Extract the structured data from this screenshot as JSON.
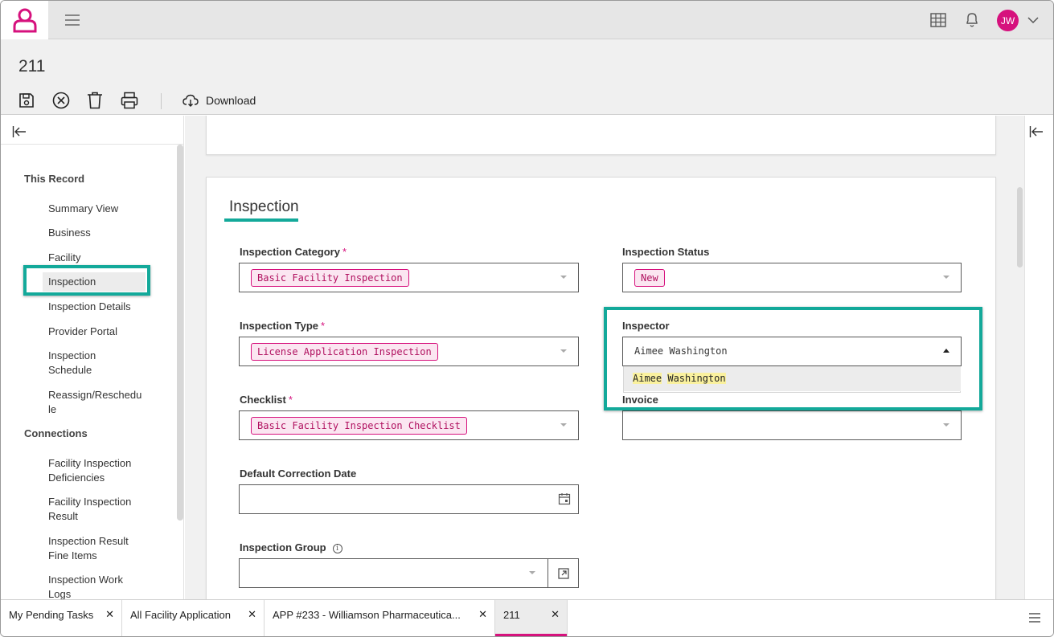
{
  "record": {
    "title": "211",
    "download_label": "Download"
  },
  "user": {
    "initials": "JW"
  },
  "colors": {
    "brand": "#d6117d",
    "accent": "#13a99a"
  },
  "nav": {
    "this_record_heading": "This Record",
    "items": [
      {
        "label": "Summary View"
      },
      {
        "label": "Business"
      },
      {
        "label": "Facility"
      },
      {
        "label": "Inspection"
      },
      {
        "label": "Inspection Details"
      },
      {
        "label": "Provider Portal"
      },
      {
        "label": "Inspection Schedule"
      },
      {
        "label": "Reassign/Reschedule"
      }
    ],
    "connections_heading": "Connections",
    "connections": [
      {
        "label": "Facility Inspection Deficiencies"
      },
      {
        "label": "Facility Inspection Result"
      },
      {
        "label": "Inspection Result Fine Items"
      },
      {
        "label": "Inspection Work Logs"
      }
    ]
  },
  "form": {
    "section_title": "Inspection",
    "inspection_category": {
      "label": "Inspection Category",
      "value": "Basic Facility Inspection"
    },
    "inspection_status": {
      "label": "Inspection Status",
      "value": "New"
    },
    "inspection_type": {
      "label": "Inspection Type",
      "value": "License Application Inspection"
    },
    "inspector": {
      "label": "Inspector",
      "value": "Aimee Washington",
      "options": [
        {
          "first": "Aimee",
          "last": "Washington"
        }
      ]
    },
    "checklist": {
      "label": "Checklist",
      "value": "Basic Facility Inspection Checklist"
    },
    "invoice": {
      "label": "Invoice",
      "value": ""
    },
    "default_correction_date": {
      "label": "Default Correction Date",
      "value": ""
    },
    "inspection_group": {
      "label": "Inspection Group",
      "value": ""
    },
    "required_mark": "*",
    "info_mark": "i"
  },
  "tabs": [
    {
      "label": "My Pending Tasks"
    },
    {
      "label": "All Facility Application"
    },
    {
      "label": "APP #233 - Williamson Pharmaceutica..."
    },
    {
      "label": "211",
      "active": true
    }
  ],
  "tab_close": "✕"
}
